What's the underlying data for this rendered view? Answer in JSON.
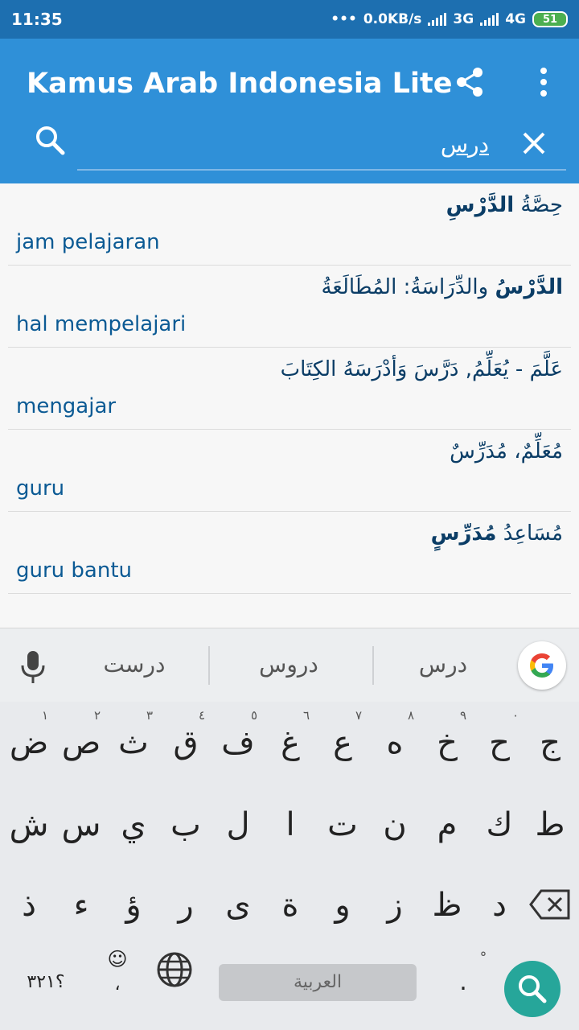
{
  "status": {
    "time": "11:35",
    "dots": "•••",
    "speed": "0.0KB/s",
    "net1": "3G",
    "net2": "4G",
    "battery": "51"
  },
  "appbar": {
    "title": "Kamus Arab Indonesia Lite",
    "search_value": "درس"
  },
  "results": [
    {
      "arabic_plain": "حِصَّةُ ",
      "arabic_bold": "الدَّرْسِ",
      "arabic_rest": "",
      "indo": "jam pelajaran"
    },
    {
      "arabic_plain": "",
      "arabic_bold": "الدَّرْسُ",
      "arabic_rest": " والدِّرَاسَةُ: المُطَالَعَةُ",
      "indo": "hal mempelajari"
    },
    {
      "arabic_plain": "عَلَّمَ - يُعَلِّمُ, دَرَّسَ وَأدْرَسَهُ الكِتَابَ",
      "arabic_bold": "",
      "arabic_rest": "",
      "indo": "mengajar"
    },
    {
      "arabic_plain": "مُعَلِّمٌ، مُدَرِّسٌ",
      "arabic_bold": "",
      "arabic_rest": "",
      "indo": "guru"
    },
    {
      "arabic_plain": "مُسَاعِدُ ",
      "arabic_bold": "مُدَرِّسٍ",
      "arabic_rest": "",
      "indo": "guru bantu"
    }
  ],
  "keyboard": {
    "suggestions": [
      "درست",
      "دروس",
      "درس"
    ],
    "row1": [
      "ض",
      "ص",
      "ث",
      "ق",
      "ف",
      "غ",
      "ع",
      "ه",
      "خ",
      "ح",
      "ج"
    ],
    "row1_hints": [
      "١",
      "٢",
      "٣",
      "٤",
      "٥",
      "٦",
      "٧",
      "٨",
      "٩",
      "٠",
      ""
    ],
    "row2": [
      "ش",
      "س",
      "ي",
      "ب",
      "ل",
      "ا",
      "ت",
      "ن",
      "م",
      "ك",
      "ط"
    ],
    "row3": [
      "ذ",
      "ء",
      "ؤ",
      "ر",
      "ى",
      "ة",
      "و",
      "ز",
      "ظ",
      "د"
    ],
    "symbols_label": "؟٣٢١",
    "emoji_label": "☺",
    "comma_label": "،",
    "space_label": "العربية",
    "period_label": ".",
    "period_hint": "ْ"
  },
  "colors": {
    "appbar": "#2f90d8",
    "statusbar": "#1d6fb0",
    "accent_fab": "#26a69a"
  }
}
